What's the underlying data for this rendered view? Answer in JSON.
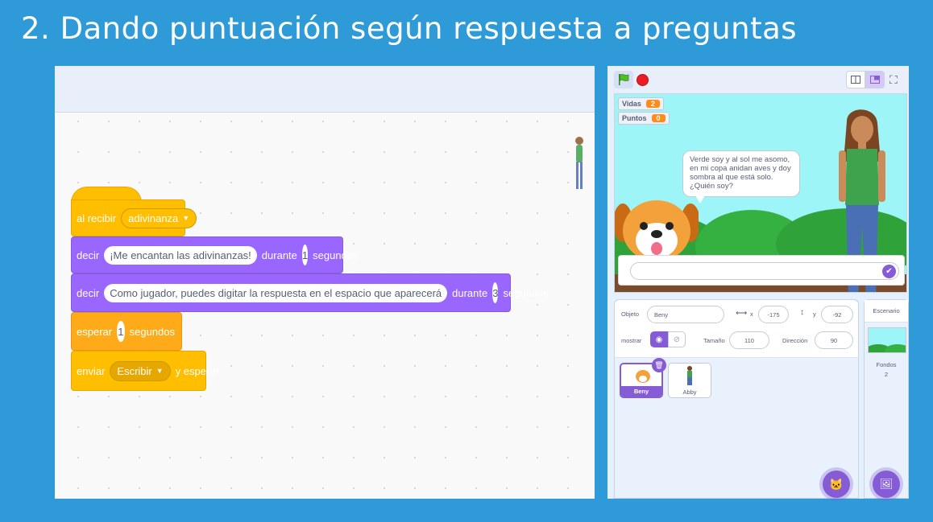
{
  "slide": {
    "title": "2. Dando puntuación según  respuesta a preguntas"
  },
  "blocks": {
    "when_receive": {
      "label": "al recibir",
      "message": "adivinanza"
    },
    "say1": {
      "label": "decir",
      "text": "¡Me encantan las adivinanzas!",
      "during": "durante",
      "secs": "1",
      "unit": "segundos"
    },
    "say2": {
      "label": "decir",
      "text": "Como jugador,  puedes digitar la respuesta en el  espacio que aparecerá",
      "during": "durante",
      "secs": "3",
      "unit": "segundos"
    },
    "wait": {
      "label": "esperar",
      "secs": "1",
      "unit": "segundos"
    },
    "broadcast": {
      "label": "enviar",
      "message": "Escribir",
      "suffix": "y esperar"
    }
  },
  "stage": {
    "monitors": [
      {
        "label": "Vidas",
        "value": "2"
      },
      {
        "label": "Puntos",
        "value": "0"
      }
    ],
    "speech": "Verde soy y al sol me asomo, en mi copa anidan aves y doy sombra al que está solo. ¿Quién soy?",
    "answer_value": ""
  },
  "sprite_info": {
    "object_label": "Objeto",
    "object_name": "Beny",
    "x_label": "x",
    "x": "-175",
    "y_label": "y",
    "y": "-92",
    "show_label": "mostrar",
    "size_label": "Tamaño",
    "size": "110",
    "direction_label": "Dirección",
    "direction": "90"
  },
  "sprites": [
    {
      "name": "Beny",
      "selected": true
    },
    {
      "name": "Abby",
      "selected": false
    }
  ],
  "stage_pane": {
    "title": "Escenario",
    "backdrops_label": "Fondos",
    "backdrops_count": "2"
  },
  "icons": [
    "green-flag-icon",
    "stop-icon",
    "small-stage-icon",
    "large-stage-icon",
    "fullscreen-icon",
    "eye-icon",
    "eye-off-icon",
    "trash-icon",
    "check-icon",
    "add-sprite-icon",
    "add-backdrop-icon"
  ],
  "colors": {
    "background": "#2e9ad8",
    "looks": "#9966ff",
    "events": "#ffbf00",
    "control": "#ffab19",
    "accent": "#855cd6"
  }
}
